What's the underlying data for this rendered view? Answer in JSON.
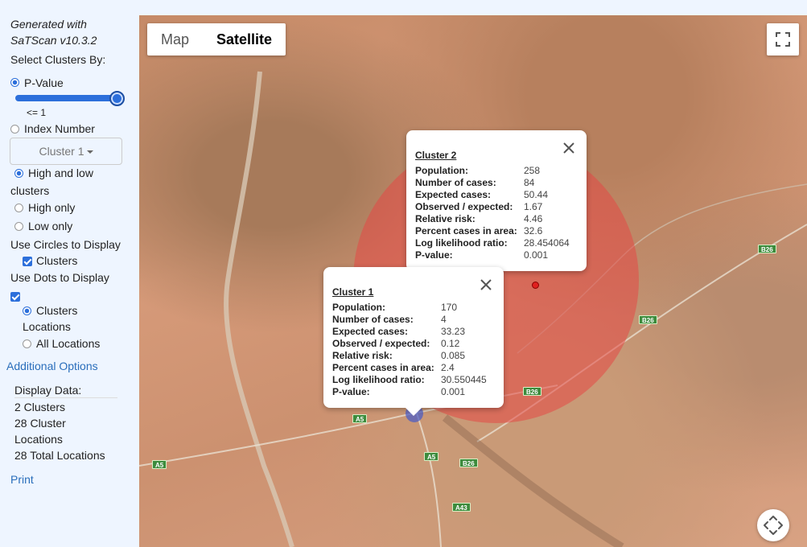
{
  "sidebar": {
    "generated_line1": "Generated with",
    "generated_line2": "SaTScan v10.3.2",
    "select_by": "Select Clusters By:",
    "pvalue_label": "P-Value",
    "slider_value": "<= 1",
    "slider_level": 1.0,
    "index_label": "Index Number",
    "dropdown_value": "Cluster 1",
    "high_low_line1": "High and low",
    "high_low_line2": "clusters",
    "high_only": "High only",
    "low_only": "Low only",
    "circles_heading": "Use Circles to Display",
    "circles_clusters": "Clusters",
    "dots_heading": "Use Dots to Display",
    "dots_clusters_locations_1": "Clusters",
    "dots_clusters_locations_2": "Locations",
    "dots_all_locations": "All Locations",
    "additional_options": "Additional Options",
    "display_data_heading": "Display Data:",
    "display_clusters": "2 Clusters",
    "display_cluster_locations_1": "28 Cluster",
    "display_cluster_locations_2": "Locations",
    "display_total_locations": "28 Total Locations",
    "print": "Print"
  },
  "map": {
    "map_button": "Map",
    "satellite_button": "Satellite",
    "road_labels": [
      "B26",
      "B26",
      "B26",
      "B26",
      "A5",
      "A5",
      "A5",
      "A43"
    ]
  },
  "cluster2": {
    "title": "Cluster 2",
    "rows": [
      {
        "k": "Population:",
        "v": "258"
      },
      {
        "k": "Number of cases:",
        "v": "84"
      },
      {
        "k": "Expected cases:",
        "v": "50.44"
      },
      {
        "k": "Observed / expected:",
        "v": "1.67"
      },
      {
        "k": "Relative risk:",
        "v": "4.46"
      },
      {
        "k": "Percent cases in area:",
        "v": "32.6"
      },
      {
        "k": "Log likelihood ratio:",
        "v": "28.454064"
      },
      {
        "k": "P-value:",
        "v": "0.001"
      }
    ]
  },
  "cluster1": {
    "title": "Cluster 1",
    "rows": [
      {
        "k": "Population:",
        "v": "170"
      },
      {
        "k": "Number of cases:",
        "v": "4"
      },
      {
        "k": "Expected cases:",
        "v": "33.23"
      },
      {
        "k": "Observed / expected:",
        "v": "0.12"
      },
      {
        "k": "Relative risk:",
        "v": "0.085"
      },
      {
        "k": "Percent cases in area:",
        "v": "2.4"
      },
      {
        "k": "Log likelihood ratio:",
        "v": "30.550445"
      },
      {
        "k": "P-value:",
        "v": "0.001"
      }
    ]
  },
  "colors": {
    "accent": "#2c6fdb",
    "link": "#2a6ebb",
    "cluster_fill": "#e44846",
    "road_shield": "#3d8b3d"
  }
}
